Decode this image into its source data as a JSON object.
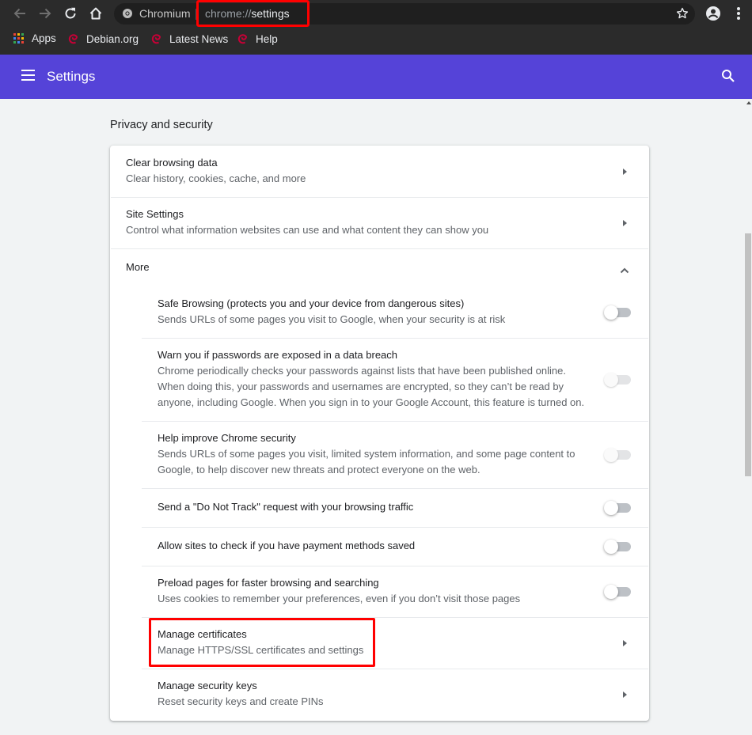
{
  "browser": {
    "site_name": "Chromium",
    "url_scheme": "chrome://",
    "url_host": "settings"
  },
  "bookmarks": [
    {
      "label": "Apps"
    },
    {
      "label": "Debian.org"
    },
    {
      "label": "Latest News"
    },
    {
      "label": "Help"
    }
  ],
  "header": {
    "title": "Settings"
  },
  "section": {
    "title": "Privacy and security"
  },
  "rows": {
    "clear": {
      "title": "Clear browsing data",
      "subtitle": "Clear history, cookies, cache, and more"
    },
    "site": {
      "title": "Site Settings",
      "subtitle": "Control what information websites can use and what content they can show you"
    },
    "more": {
      "title": "More"
    },
    "safe": {
      "title": "Safe Browsing (protects you and your device from dangerous sites)",
      "subtitle": "Sends URLs of some pages you visit to Google, when your security is at risk",
      "enabled": false
    },
    "warn": {
      "title": "Warn you if passwords are exposed in a data breach",
      "line1": "Chrome periodically checks your passwords against lists that have been published online.",
      "line2": "When doing this, your passwords and usernames are encrypted, so they can’t be read by",
      "line3": "anyone, including Google. When you sign in to your Google Account, this feature is turned on.",
      "enabled": false
    },
    "improve": {
      "title": "Help improve Chrome security",
      "line1": "Sends URLs of some pages you visit, limited system information, and some page content to",
      "line2": "Google, to help discover new threats and protect everyone on the web.",
      "enabled": false
    },
    "dnt": {
      "title": "Send a \"Do Not Track\" request with your browsing traffic",
      "enabled": false
    },
    "payment": {
      "title": "Allow sites to check if you have payment methods saved",
      "enabled": false
    },
    "preload": {
      "title": "Preload pages for faster browsing and searching",
      "subtitle": "Uses cookies to remember your preferences, even if you don’t visit those pages",
      "enabled": false
    },
    "certs": {
      "title": "Manage certificates",
      "subtitle": "Manage HTTPS/SSL certificates and settings"
    },
    "keys": {
      "title": "Manage security keys",
      "subtitle": "Reset security keys and create PINs"
    }
  },
  "colors": {
    "header": "#5543d8",
    "highlight": "#ff0000",
    "chrome": "#2b2b2b"
  }
}
